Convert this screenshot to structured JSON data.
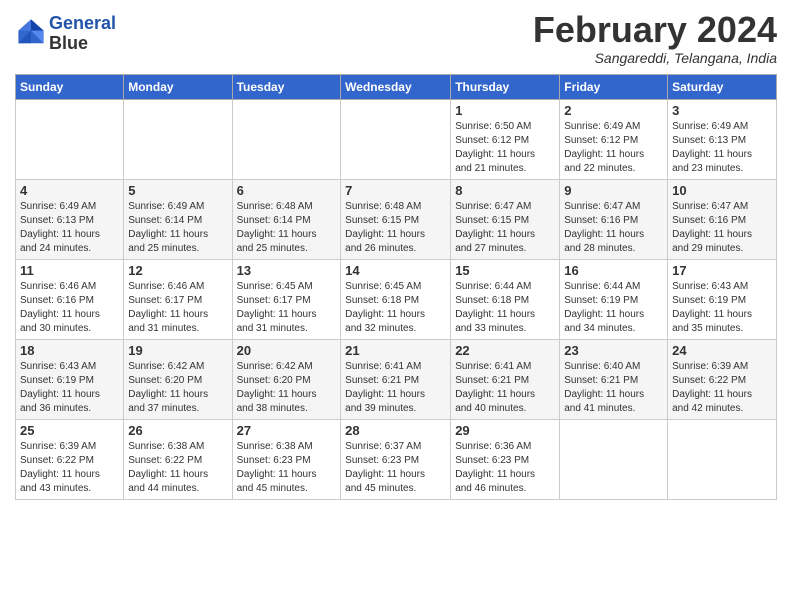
{
  "logo": {
    "line1": "General",
    "line2": "Blue"
  },
  "title": "February 2024",
  "subtitle": "Sangareddi, Telangana, India",
  "days_of_week": [
    "Sunday",
    "Monday",
    "Tuesday",
    "Wednesday",
    "Thursday",
    "Friday",
    "Saturday"
  ],
  "weeks": [
    [
      {
        "day": "",
        "info": ""
      },
      {
        "day": "",
        "info": ""
      },
      {
        "day": "",
        "info": ""
      },
      {
        "day": "",
        "info": ""
      },
      {
        "day": "1",
        "info": "Sunrise: 6:50 AM\nSunset: 6:12 PM\nDaylight: 11 hours\nand 21 minutes."
      },
      {
        "day": "2",
        "info": "Sunrise: 6:49 AM\nSunset: 6:12 PM\nDaylight: 11 hours\nand 22 minutes."
      },
      {
        "day": "3",
        "info": "Sunrise: 6:49 AM\nSunset: 6:13 PM\nDaylight: 11 hours\nand 23 minutes."
      }
    ],
    [
      {
        "day": "4",
        "info": "Sunrise: 6:49 AM\nSunset: 6:13 PM\nDaylight: 11 hours\nand 24 minutes."
      },
      {
        "day": "5",
        "info": "Sunrise: 6:49 AM\nSunset: 6:14 PM\nDaylight: 11 hours\nand 25 minutes."
      },
      {
        "day": "6",
        "info": "Sunrise: 6:48 AM\nSunset: 6:14 PM\nDaylight: 11 hours\nand 25 minutes."
      },
      {
        "day": "7",
        "info": "Sunrise: 6:48 AM\nSunset: 6:15 PM\nDaylight: 11 hours\nand 26 minutes."
      },
      {
        "day": "8",
        "info": "Sunrise: 6:47 AM\nSunset: 6:15 PM\nDaylight: 11 hours\nand 27 minutes."
      },
      {
        "day": "9",
        "info": "Sunrise: 6:47 AM\nSunset: 6:16 PM\nDaylight: 11 hours\nand 28 minutes."
      },
      {
        "day": "10",
        "info": "Sunrise: 6:47 AM\nSunset: 6:16 PM\nDaylight: 11 hours\nand 29 minutes."
      }
    ],
    [
      {
        "day": "11",
        "info": "Sunrise: 6:46 AM\nSunset: 6:16 PM\nDaylight: 11 hours\nand 30 minutes."
      },
      {
        "day": "12",
        "info": "Sunrise: 6:46 AM\nSunset: 6:17 PM\nDaylight: 11 hours\nand 31 minutes."
      },
      {
        "day": "13",
        "info": "Sunrise: 6:45 AM\nSunset: 6:17 PM\nDaylight: 11 hours\nand 31 minutes."
      },
      {
        "day": "14",
        "info": "Sunrise: 6:45 AM\nSunset: 6:18 PM\nDaylight: 11 hours\nand 32 minutes."
      },
      {
        "day": "15",
        "info": "Sunrise: 6:44 AM\nSunset: 6:18 PM\nDaylight: 11 hours\nand 33 minutes."
      },
      {
        "day": "16",
        "info": "Sunrise: 6:44 AM\nSunset: 6:19 PM\nDaylight: 11 hours\nand 34 minutes."
      },
      {
        "day": "17",
        "info": "Sunrise: 6:43 AM\nSunset: 6:19 PM\nDaylight: 11 hours\nand 35 minutes."
      }
    ],
    [
      {
        "day": "18",
        "info": "Sunrise: 6:43 AM\nSunset: 6:19 PM\nDaylight: 11 hours\nand 36 minutes."
      },
      {
        "day": "19",
        "info": "Sunrise: 6:42 AM\nSunset: 6:20 PM\nDaylight: 11 hours\nand 37 minutes."
      },
      {
        "day": "20",
        "info": "Sunrise: 6:42 AM\nSunset: 6:20 PM\nDaylight: 11 hours\nand 38 minutes."
      },
      {
        "day": "21",
        "info": "Sunrise: 6:41 AM\nSunset: 6:21 PM\nDaylight: 11 hours\nand 39 minutes."
      },
      {
        "day": "22",
        "info": "Sunrise: 6:41 AM\nSunset: 6:21 PM\nDaylight: 11 hours\nand 40 minutes."
      },
      {
        "day": "23",
        "info": "Sunrise: 6:40 AM\nSunset: 6:21 PM\nDaylight: 11 hours\nand 41 minutes."
      },
      {
        "day": "24",
        "info": "Sunrise: 6:39 AM\nSunset: 6:22 PM\nDaylight: 11 hours\nand 42 minutes."
      }
    ],
    [
      {
        "day": "25",
        "info": "Sunrise: 6:39 AM\nSunset: 6:22 PM\nDaylight: 11 hours\nand 43 minutes."
      },
      {
        "day": "26",
        "info": "Sunrise: 6:38 AM\nSunset: 6:22 PM\nDaylight: 11 hours\nand 44 minutes."
      },
      {
        "day": "27",
        "info": "Sunrise: 6:38 AM\nSunset: 6:23 PM\nDaylight: 11 hours\nand 45 minutes."
      },
      {
        "day": "28",
        "info": "Sunrise: 6:37 AM\nSunset: 6:23 PM\nDaylight: 11 hours\nand 45 minutes."
      },
      {
        "day": "29",
        "info": "Sunrise: 6:36 AM\nSunset: 6:23 PM\nDaylight: 11 hours\nand 46 minutes."
      },
      {
        "day": "",
        "info": ""
      },
      {
        "day": "",
        "info": ""
      }
    ]
  ]
}
